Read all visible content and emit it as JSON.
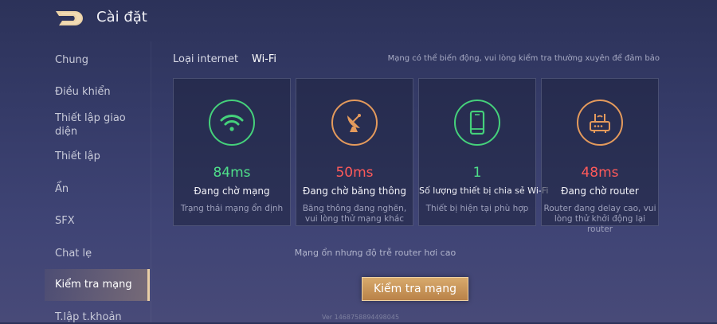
{
  "header": {
    "title": "Cài đặt"
  },
  "sidebar": {
    "items": [
      {
        "label": "Chung"
      },
      {
        "label": "Điều khiển"
      },
      {
        "label": "Thiết lập giao diện"
      },
      {
        "label": "Thiết lập"
      },
      {
        "label": "Ẩn"
      },
      {
        "label": "SFX"
      },
      {
        "label": "Chat lẹ"
      },
      {
        "label": "Kiểm tra mạng"
      },
      {
        "label": "T.lập t.khoản"
      }
    ]
  },
  "tabs": {
    "internet_label": "Loại internet",
    "wifi_label": "Wi-Fi"
  },
  "notice_top": "Mạng có thể biến động, vui lòng kiểm tra thường xuyên để đảm bảo",
  "cards": [
    {
      "icon": "wifi-icon",
      "value": "84ms",
      "label": "Đang chờ mạng",
      "desc": "Trạng thái mạng ổn định"
    },
    {
      "icon": "satellite-dish-icon",
      "value": "50ms",
      "label": "Đang chờ băng thông",
      "desc": "Băng thông đang nghẽn, vui lòng thử mạng khác"
    },
    {
      "icon": "phone-icon",
      "value": "1",
      "label": "Số lượng thiết bị chia sẻ Wi-Fi",
      "desc": "Thiết bị hiện tại phù hợp"
    },
    {
      "icon": "router-icon",
      "value": "48ms",
      "label": "Đang chờ router",
      "desc": "Router đang delay cao, vui lòng thử khởi động lại router"
    }
  ],
  "notice_bottom": "Mạng ổn nhưng độ trễ router hơi cao",
  "check_button_label": "Kiểm tra mạng",
  "version": "Ver 1468758894498045",
  "colors": {
    "good": "#4fe08a",
    "bad": "#ff5a5a",
    "accent": "#d8aa6c"
  }
}
